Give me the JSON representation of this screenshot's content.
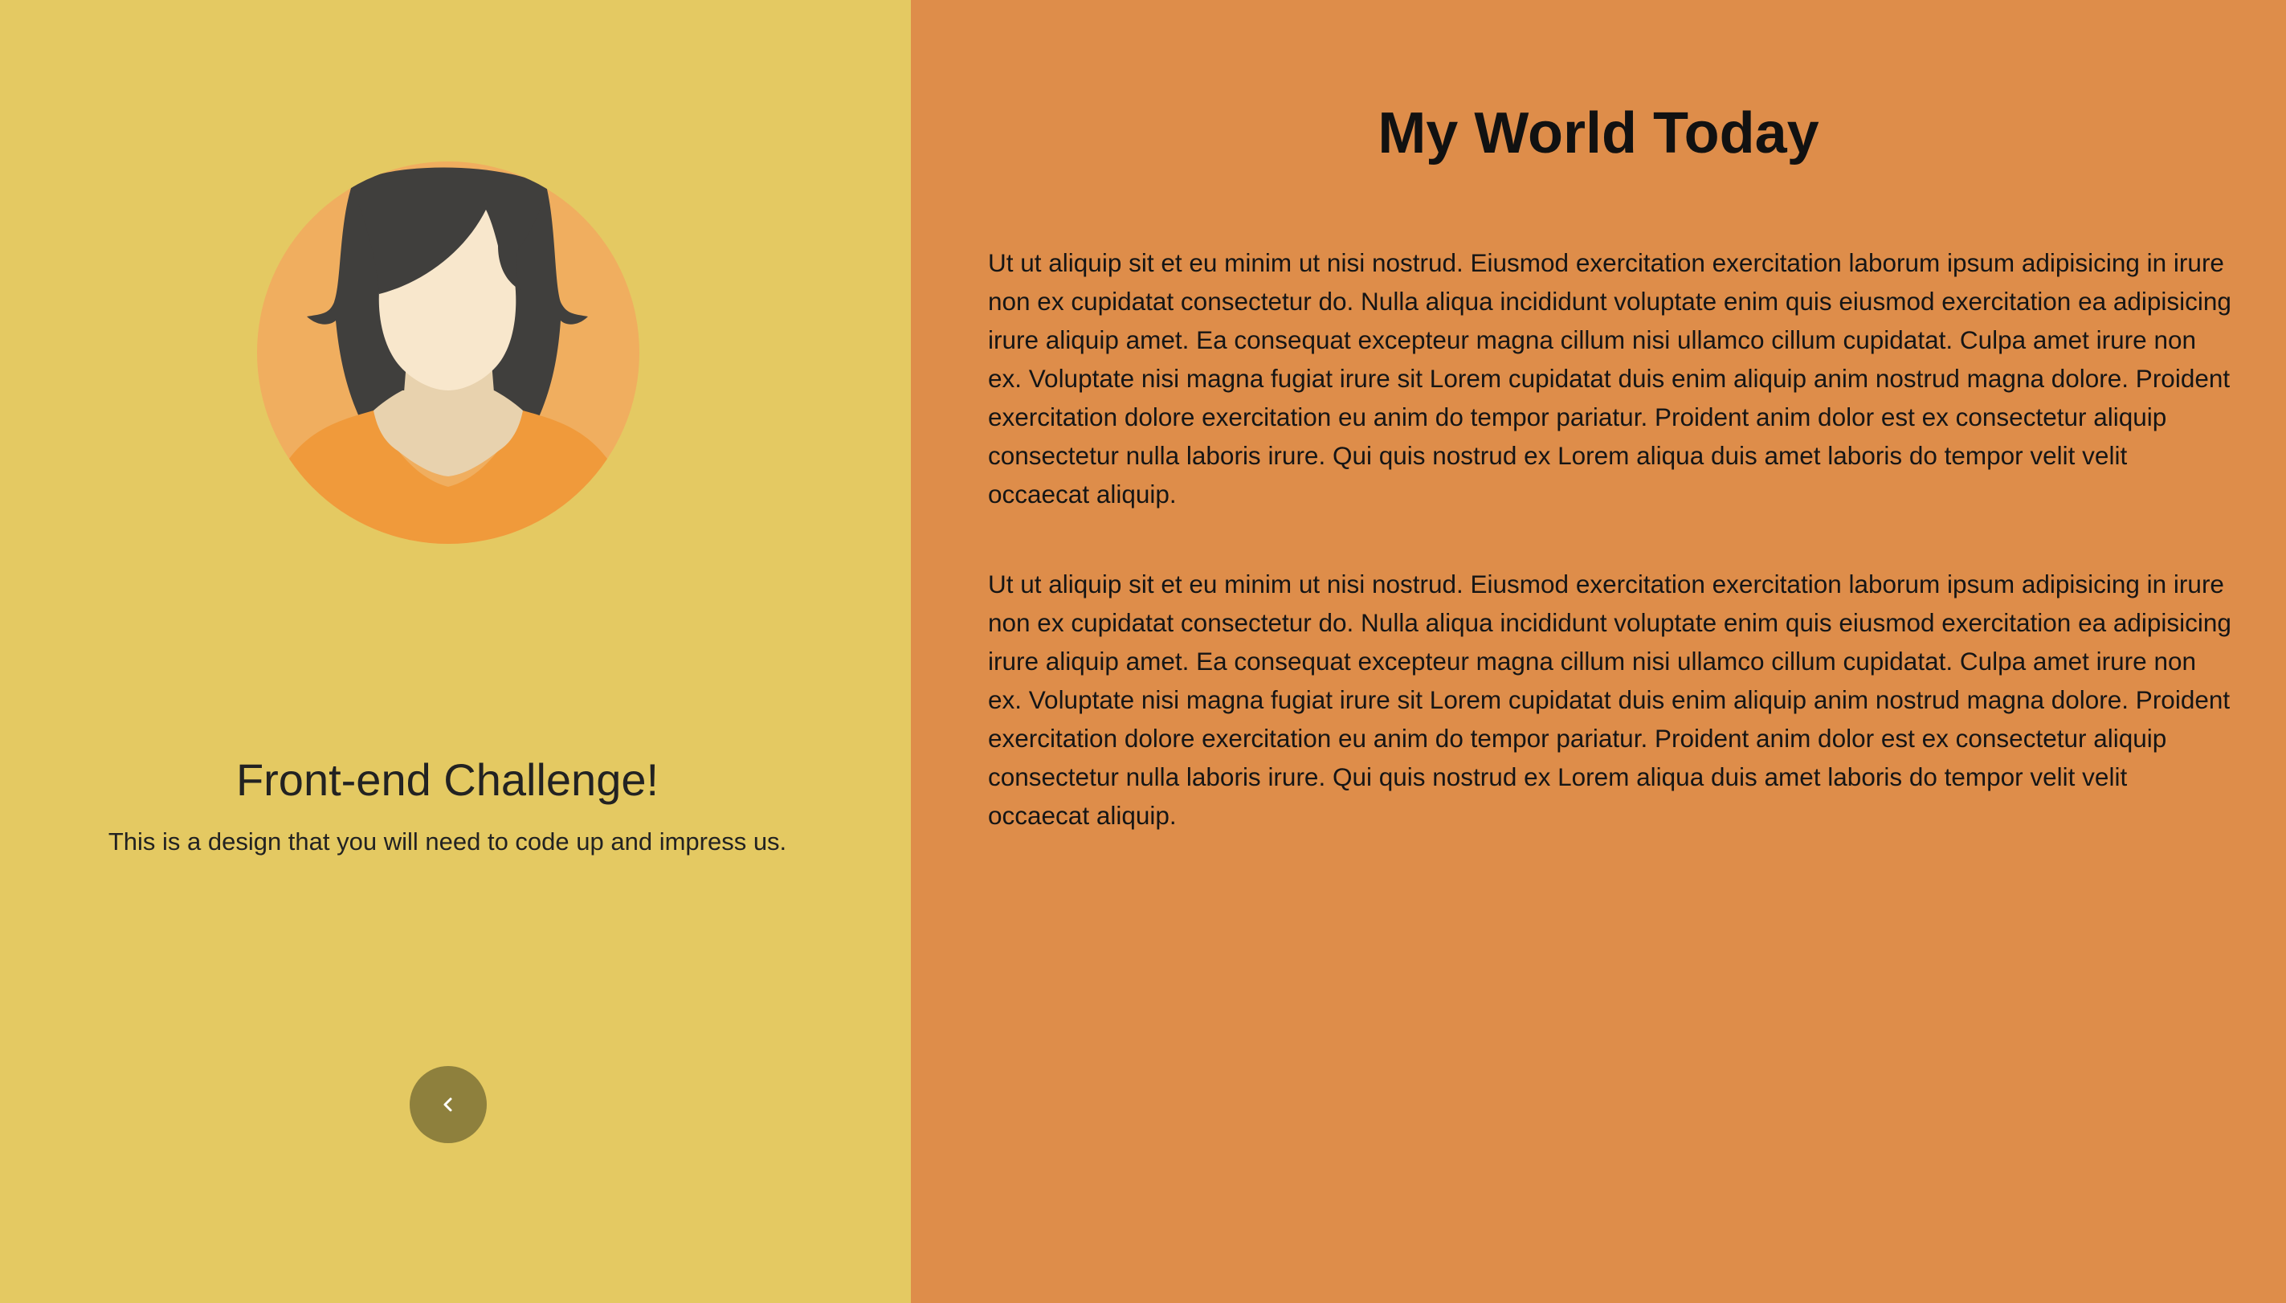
{
  "left_panel": {
    "background": "#e4c962",
    "avatar_icon": "woman-avatar-icon",
    "challenge_title": "Front-end Challenge!",
    "challenge_subtitle": "This is a design that you will need to code up and impress us.",
    "back_button_icon": "chevron-left-icon"
  },
  "right_panel": {
    "background": "#de8d4a",
    "title": "My World Today",
    "paragraphs": [
      "Ut ut aliquip sit et eu minim ut nisi nostrud. Eiusmod exercitation exercitation laborum ipsum adipisicing in irure non ex cupidatat consectetur do. Nulla aliqua incididunt voluptate enim quis eiusmod exercitation ea adipisicing irure aliquip amet. Ea consequat excepteur magna cillum nisi ullamco cillum cupidatat. Culpa amet irure non ex. Voluptate nisi magna fugiat irure sit Lorem cupidatat duis enim aliquip anim nostrud magna dolore. Proident exercitation dolore exercitation eu anim do tempor pariatur. Proident anim dolor est ex consectetur aliquip consectetur nulla laboris irure. Qui quis nostrud ex Lorem aliqua duis amet laboris do tempor velit velit occaecat aliquip.",
      "Ut ut aliquip sit et eu minim ut nisi nostrud. Eiusmod exercitation exercitation laborum ipsum adipisicing in irure non ex cupidatat consectetur do. Nulla aliqua incididunt voluptate enim quis eiusmod exercitation ea adipisicing irure aliquip amet. Ea consequat excepteur magna cillum nisi ullamco cillum cupidatat. Culpa amet irure non ex. Voluptate nisi magna fugiat irure sit Lorem cupidatat duis enim aliquip anim nostrud magna dolore. Proident exercitation dolore exercitation eu anim do tempor pariatur. Proident anim dolor est ex consectetur aliquip consectetur nulla laboris irure. Qui quis nostrud ex Lorem aliqua duis amet laboris do tempor velit velit occaecat aliquip."
    ]
  }
}
